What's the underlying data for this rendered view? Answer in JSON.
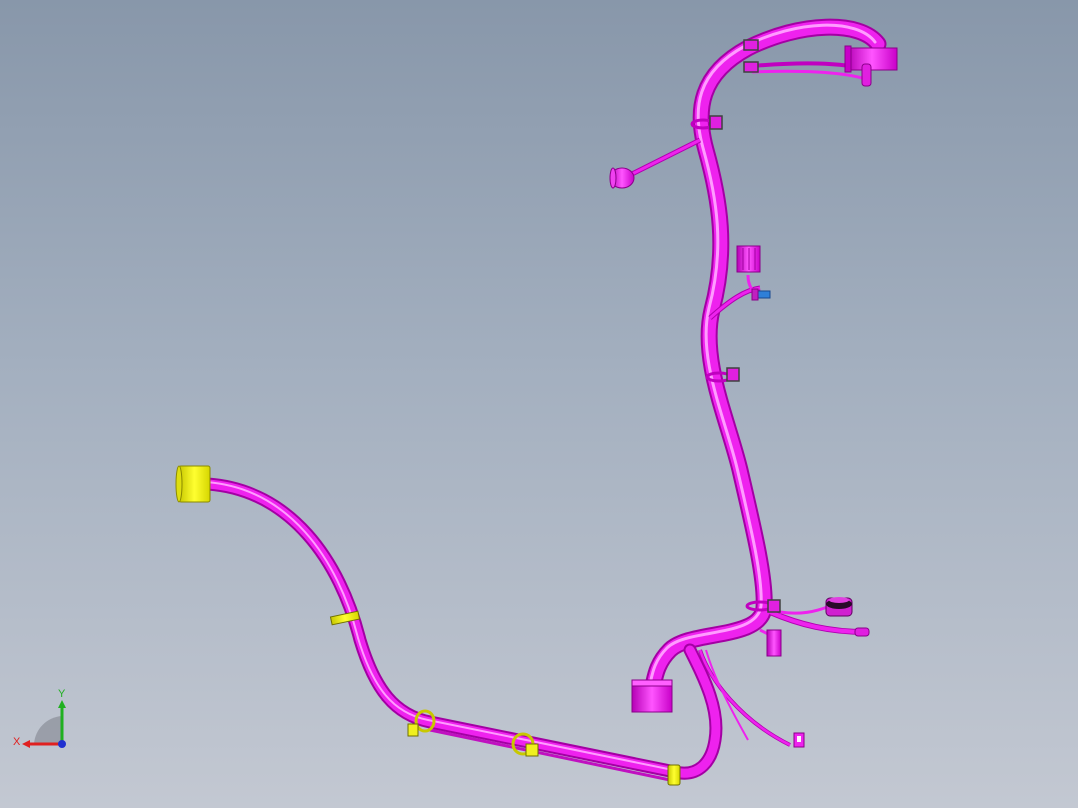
{
  "viewport": {
    "model": "wire-harness-assembly",
    "background_top": "#8897aa",
    "background_bottom": "#c3c8d2"
  },
  "colors": {
    "harness": "#ee22ee",
    "harness_highlight": "#ff88ff",
    "harness_shadow": "#a000a0",
    "connector_yellow": "#f2f20a",
    "clip_blue": "#2f7fd8"
  },
  "triad": {
    "x_label": "X",
    "y_label": "Y",
    "x_color": "#e02020",
    "y_color": "#20b020",
    "z_color": "#2030d0"
  }
}
